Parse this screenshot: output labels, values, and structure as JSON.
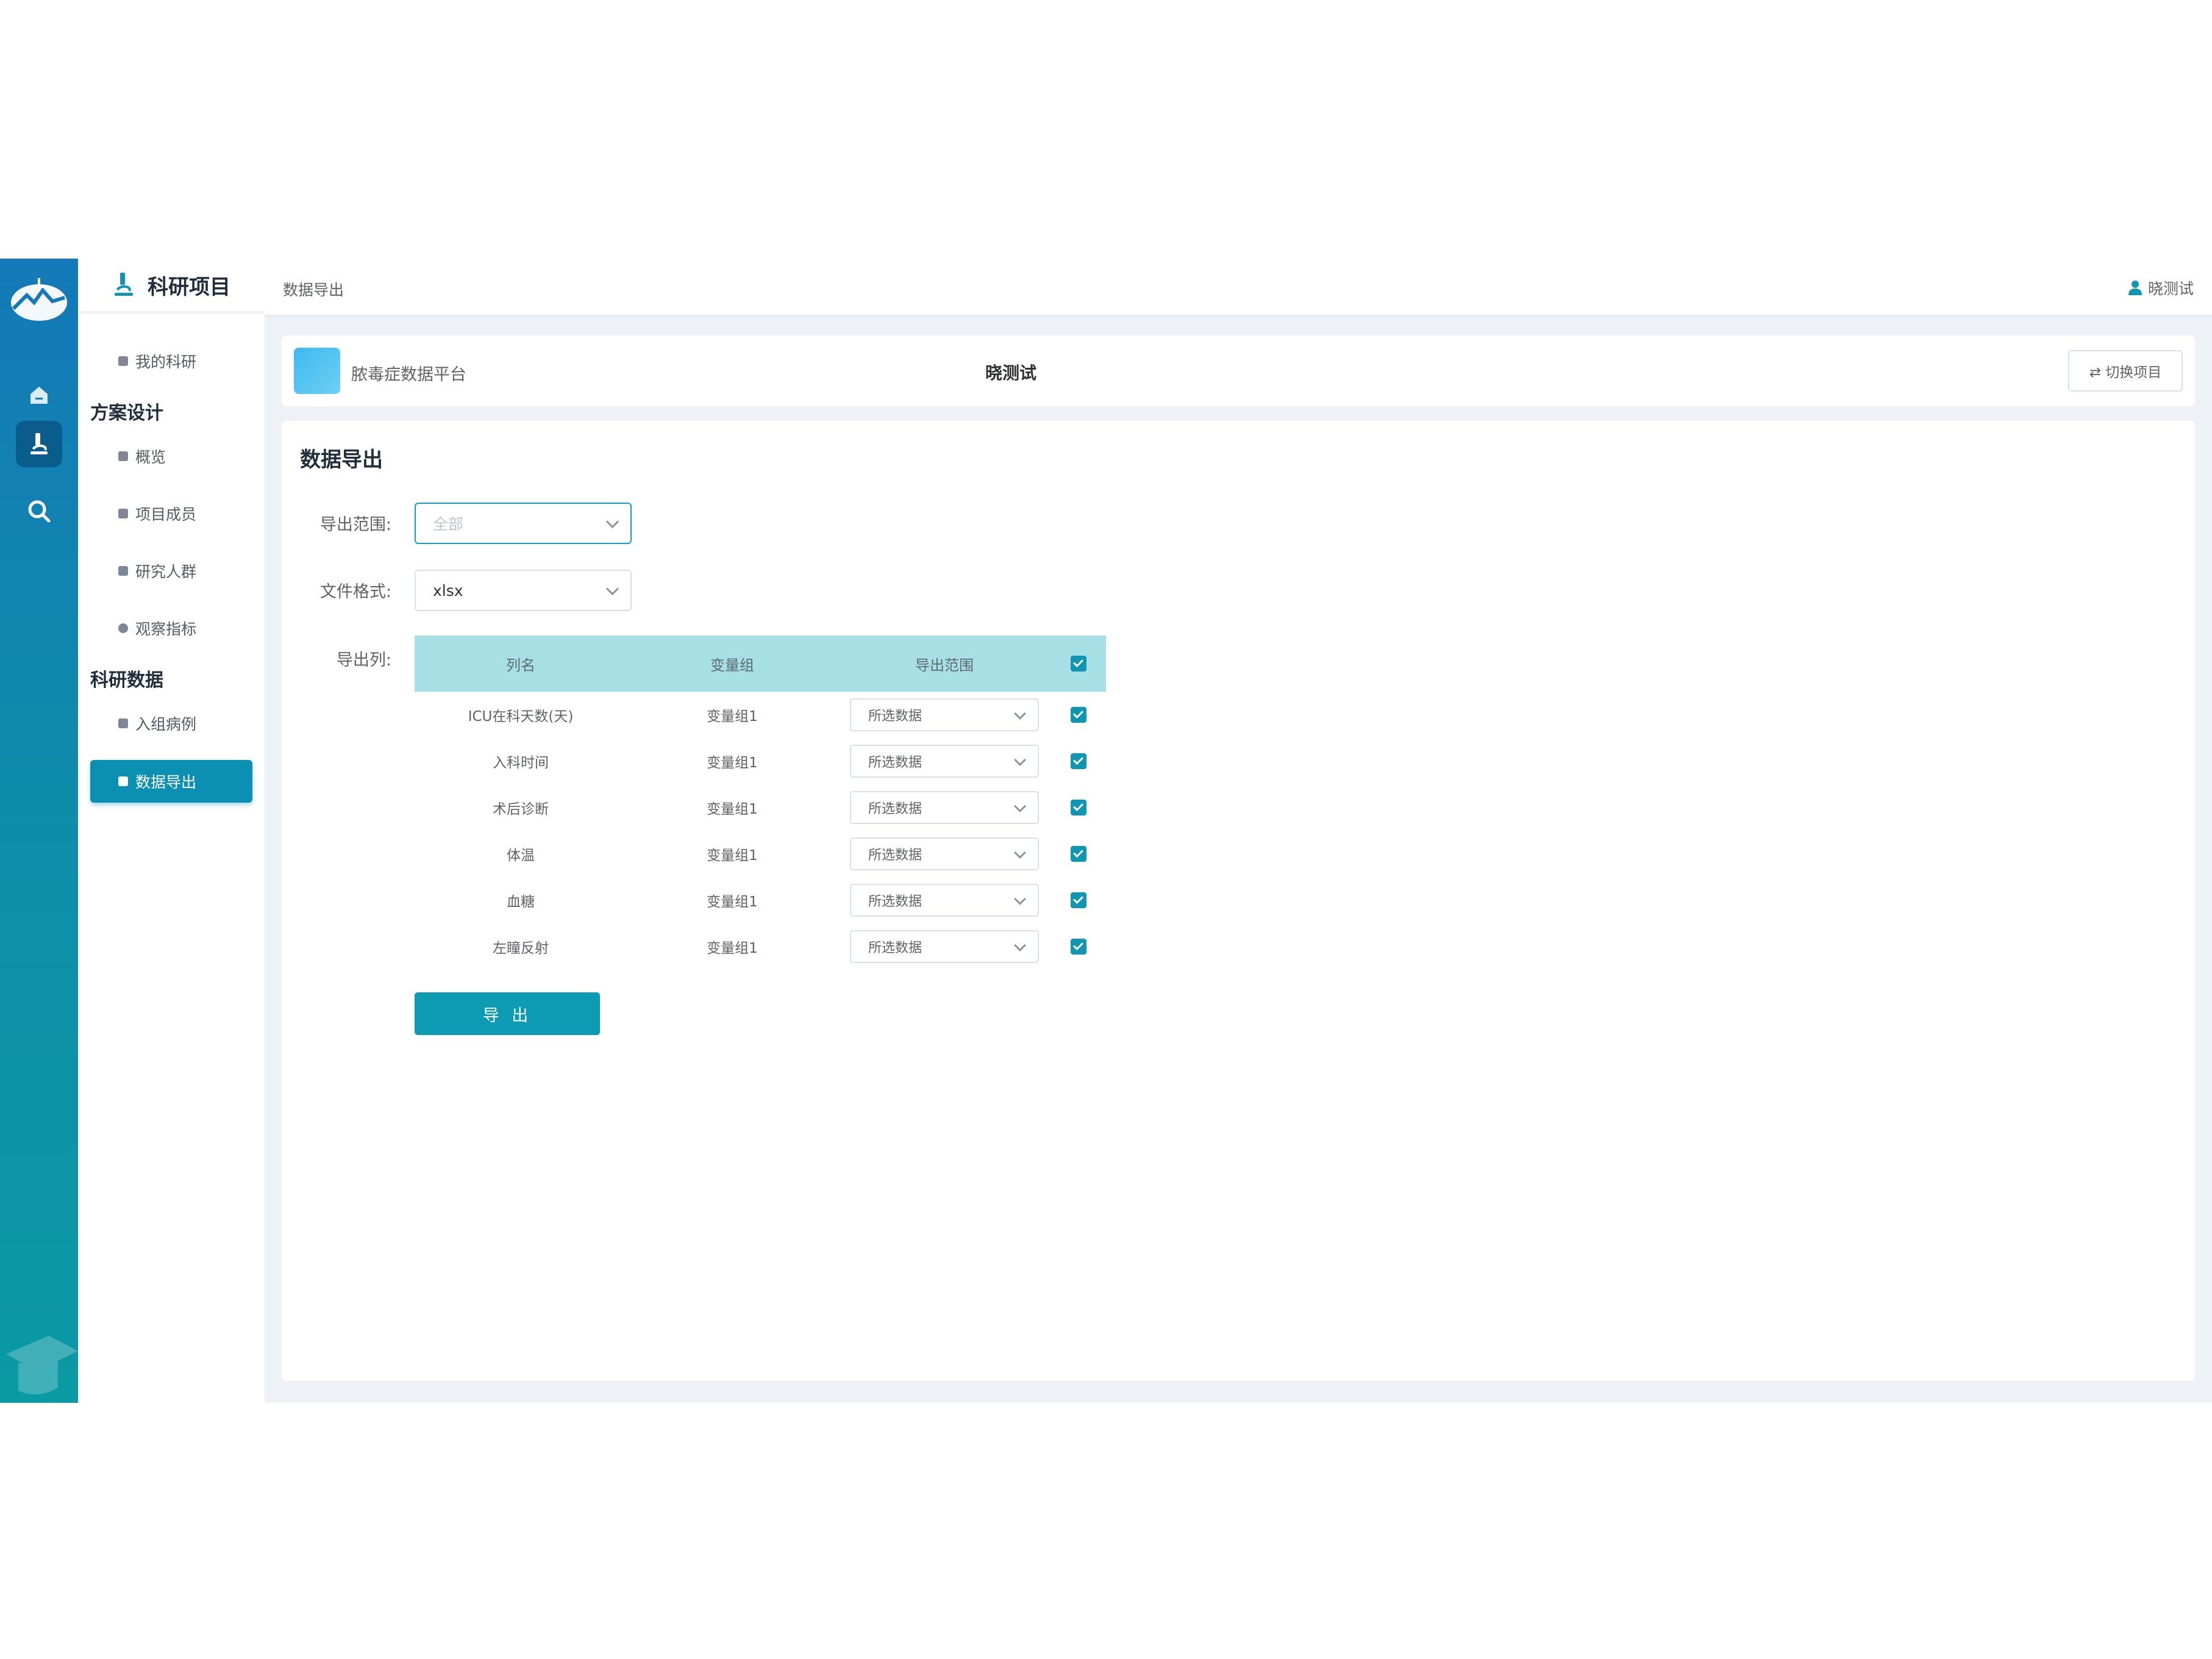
{
  "menu": {
    "title": "科研项目",
    "my_research": "我的科研",
    "group_design": "方案设计",
    "overview": "概览",
    "members": "项目成员",
    "cohort": "研究人群",
    "indicators": "观察指标",
    "group_data": "科研数据",
    "cases": "入组病例",
    "export": "数据导出"
  },
  "header": {
    "breadcrumb": "数据导出",
    "user": "晓测试"
  },
  "project": {
    "name": "脓毒症数据平台",
    "owner": "晓测试",
    "switch_label": "⇄ 切换项目"
  },
  "page": {
    "title": "数据导出",
    "range_label": "导出范围:",
    "range_placeholder": "全部",
    "format_label": "文件格式:",
    "format_value": "xlsx",
    "columns_label": "导出列:",
    "export_button": "导 出"
  },
  "table": {
    "headers": [
      "列名",
      "变量组",
      "导出范围"
    ],
    "rows": [
      {
        "name": "ICU在科天数(天)",
        "group": "变量组1",
        "range": "所选数据",
        "checked": true
      },
      {
        "name": "入科时间",
        "group": "变量组1",
        "range": "所选数据",
        "checked": true
      },
      {
        "name": "术后诊断",
        "group": "变量组1",
        "range": "所选数据",
        "checked": true
      },
      {
        "name": "体温",
        "group": "变量组1",
        "range": "所选数据",
        "checked": true
      },
      {
        "name": "血糖",
        "group": "变量组1",
        "range": "所选数据",
        "checked": true
      },
      {
        "name": "左瞳反射",
        "group": "变量组1",
        "range": "所选数据",
        "checked": true
      }
    ]
  },
  "icons": {
    "rail": [
      "logo-icon",
      "home-icon",
      "microscope-icon",
      "search-icon"
    ],
    "accent": "#0e96b3"
  }
}
